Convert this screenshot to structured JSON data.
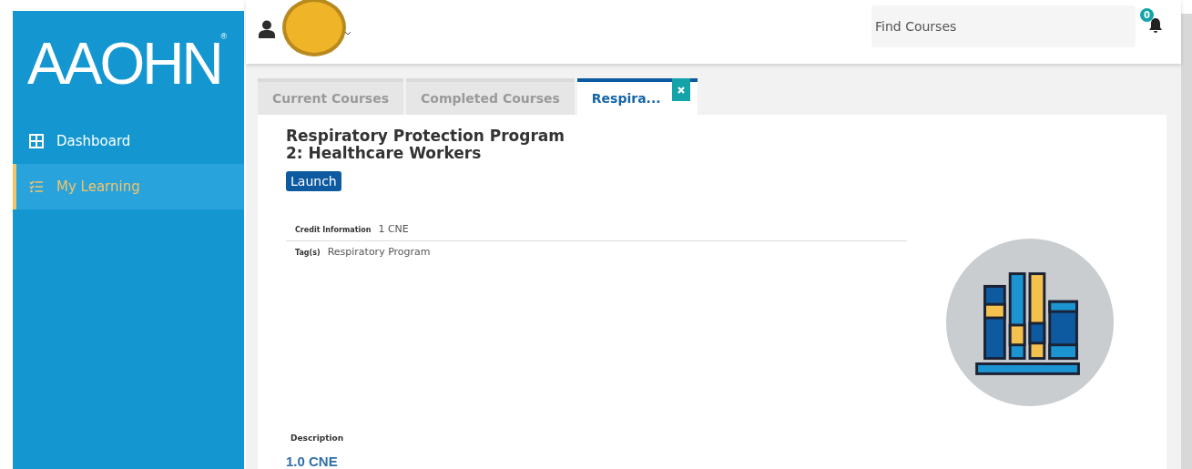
{
  "logo": {
    "text": "AAOHN",
    "mark": "®"
  },
  "sidebar": {
    "items": [
      {
        "label": "Dashboard",
        "kind": "grid",
        "selected": false
      },
      {
        "label": "My Learning",
        "kind": "checklist",
        "selected": true
      }
    ]
  },
  "topbar": {
    "search": {
      "placeholder": "Find Courses"
    },
    "notifications": {
      "count": "0"
    }
  },
  "tabs": [
    {
      "label": "Current Courses",
      "selected": false,
      "closable": false
    },
    {
      "label": "Completed Courses",
      "selected": false,
      "closable": false
    },
    {
      "label": "Respira...",
      "selected": true,
      "closable": true
    }
  ],
  "course": {
    "title_lines": [
      "Respiratory Protection Program",
      "2: Healthcare Workers"
    ],
    "launch": "Launch",
    "details": [
      {
        "label": "Credit Information",
        "value": "1 CNE"
      },
      {
        "label": "Tag(s)",
        "value": "Respiratory Program"
      }
    ],
    "description_label": "Description",
    "description": "1.0 CNE"
  }
}
